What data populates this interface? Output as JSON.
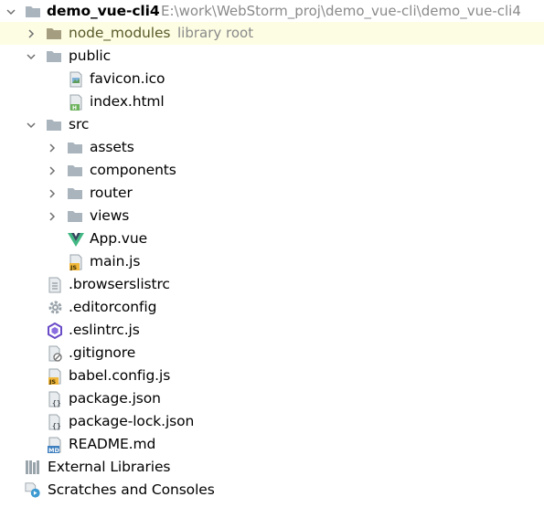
{
  "project": {
    "name": "demo_vue-cli4",
    "path": "E:\\work\\WebStorm_proj\\demo_vue-cli\\demo_vue-cli4"
  },
  "node_modules": {
    "name": "node_modules",
    "hint": "library root"
  },
  "public": {
    "name": "public",
    "children": [
      "favicon.ico",
      "index.html"
    ]
  },
  "src": {
    "name": "src",
    "folders": [
      "assets",
      "components",
      "router",
      "views"
    ],
    "files": [
      "App.vue",
      "main.js"
    ]
  },
  "root_files": [
    ".browserslistrc",
    ".editorconfig",
    ".eslintrc.js",
    ".gitignore",
    "babel.config.js",
    "package.json",
    "package-lock.json",
    "README.md"
  ],
  "bottom": {
    "external_libraries": "External Libraries",
    "scratches": "Scratches and Consoles"
  },
  "icons": {
    "folder": "folder-icon",
    "arrow_open": "chevron-down-icon",
    "arrow_closed": "chevron-right-icon"
  },
  "colors": {
    "folder": "#a9b4bd",
    "excluded_folder": "#a59d80",
    "vue_green": "#41b883",
    "vue_dark": "#35495e",
    "js_badge": "#f0b73a",
    "html_badge": "#6db35e",
    "md_badge": "#3d7fbf",
    "eslint": "#6a4bc7",
    "selected_row": "#fdfde4"
  }
}
